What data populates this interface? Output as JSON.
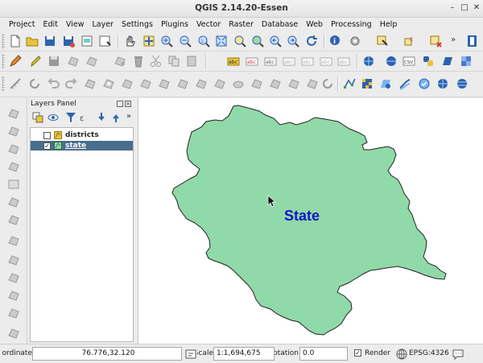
{
  "window": {
    "title": "QGIS 2.14.20-Essen",
    "controls": [
      "–",
      "□",
      "✕"
    ]
  },
  "menu": [
    "Project",
    "Edit",
    "View",
    "Layer",
    "Settings",
    "Plugins",
    "Vector",
    "Raster",
    "Database",
    "Web",
    "Processing",
    "Help"
  ],
  "layers_panel": {
    "title": "Layers Panel",
    "layers": [
      {
        "name": "districts",
        "checked": false,
        "selected": false,
        "check_mark": ""
      },
      {
        "name": "state",
        "checked": true,
        "selected": true,
        "check_mark": "✓"
      }
    ]
  },
  "map": {
    "label": "State",
    "fill_color": "#90d9a8",
    "stroke_color": "#222222",
    "label_color": "#1414c8"
  },
  "status": {
    "coordinate_label": "Coordinate",
    "coordinate_value": "76.776,32.120",
    "scale_label": "Scale",
    "scale_value": "1:1,694,675",
    "rotation_label": "Rotation",
    "rotation_value": "0.0",
    "render_label": "Render",
    "render_checked": true,
    "render_check_mark": "✓",
    "crs": "EPSG:4326"
  },
  "more_glyph": "»",
  "colors": {
    "selection": "#4a6d8c",
    "accent_blue": "#2d62b0",
    "accent_yellow": "#e8c53a"
  }
}
